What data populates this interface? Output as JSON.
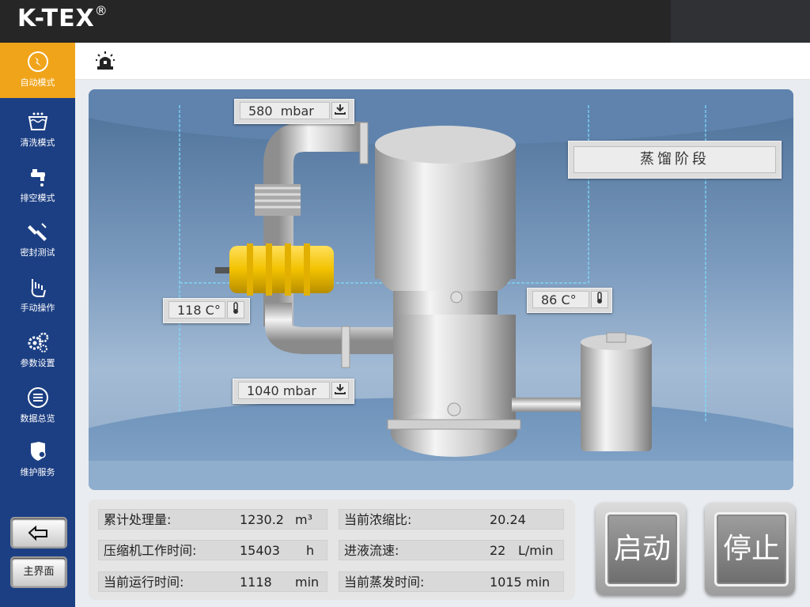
{
  "app": {
    "brand": "K-TEX",
    "brand_mark": "®"
  },
  "sidebar": {
    "items": [
      {
        "label": "自动模式",
        "icon": "auto-mode-icon",
        "active": true
      },
      {
        "label": "清洗模式",
        "icon": "wash-icon",
        "active": false
      },
      {
        "label": "排空模式",
        "icon": "drain-faucet-icon",
        "active": false
      },
      {
        "label": "密封测试",
        "icon": "seal-test-icon",
        "active": false
      },
      {
        "label": "手动操作",
        "icon": "manual-hand-icon",
        "active": false
      },
      {
        "label": "参数设置",
        "icon": "gears-icon",
        "active": false
      },
      {
        "label": "数据总览",
        "icon": "list-icon",
        "active": false
      },
      {
        "label": "维护服务",
        "icon": "shield-user-icon",
        "active": false
      }
    ],
    "back_icon": "return-arrow-icon",
    "home_label": "主界面"
  },
  "header": {
    "alarm_icon": "alarm-beacon-icon"
  },
  "scene": {
    "pressure_top": {
      "value": "580",
      "unit": "mbar"
    },
    "pressure_bottom": {
      "value": "1040",
      "unit": "mbar"
    },
    "temp_left": {
      "value": "118",
      "unit": "C°"
    },
    "temp_right": {
      "value": "86",
      "unit": "C°"
    },
    "phase": "蒸馏阶段"
  },
  "stats": {
    "total_processed": {
      "label": "累计处理量:",
      "value": "1230.2",
      "unit": "m³"
    },
    "compressor_time": {
      "label": "压缩机工作时间:",
      "value": "15403",
      "unit": "h"
    },
    "current_run_time": {
      "label": "当前运行时间:",
      "value": "1118",
      "unit": "min"
    },
    "concentration_ratio": {
      "label": "当前浓缩比:",
      "value": "20.24",
      "unit": ""
    },
    "feed_flow": {
      "label": "进液流速:",
      "value": "22",
      "unit": "L/min"
    },
    "evaporation_time": {
      "label": "当前蒸发时间:",
      "value": "1015",
      "unit": "min"
    }
  },
  "controls": {
    "start_label": "启动",
    "stop_label": "停止"
  },
  "colors": {
    "sidebar": "#1c3f83",
    "active": "#f0a41a",
    "topbar": "#262626",
    "pump": "#f2c200"
  }
}
